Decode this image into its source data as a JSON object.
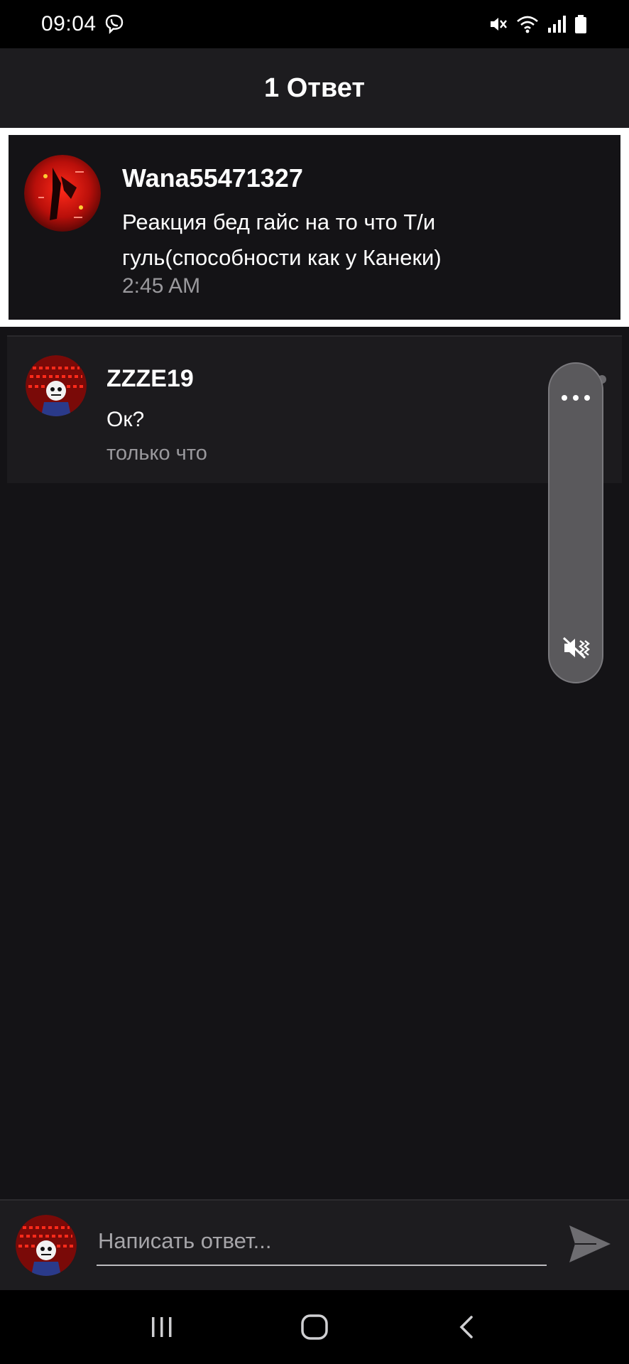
{
  "status_bar": {
    "time": "09:04",
    "icons": [
      "viber-icon",
      "mute-icon",
      "wifi-icon",
      "signal-icon",
      "battery-icon"
    ]
  },
  "header": {
    "title": "1 Ответ"
  },
  "original_comment": {
    "username": "Wana55471327",
    "text": "Реакция бед гайс на то что Т/и гуль(способности как у Канеки)",
    "time": "2:45 AM"
  },
  "reply": {
    "username": "ZZZE19",
    "text": "Ок?",
    "time": "только что"
  },
  "volume_overlay": {
    "icons": [
      "more-options-icon",
      "vibrate-mute-icon"
    ]
  },
  "reply_input": {
    "placeholder": "Написать ответ...",
    "value": ""
  },
  "nav_bar": {
    "buttons": [
      "recent-apps-icon",
      "home-icon",
      "back-icon"
    ]
  },
  "colors": {
    "background": "#141316",
    "header": "#1d1c1f",
    "muted_text": "#9a999d",
    "highlight_border": "#ffffff"
  }
}
